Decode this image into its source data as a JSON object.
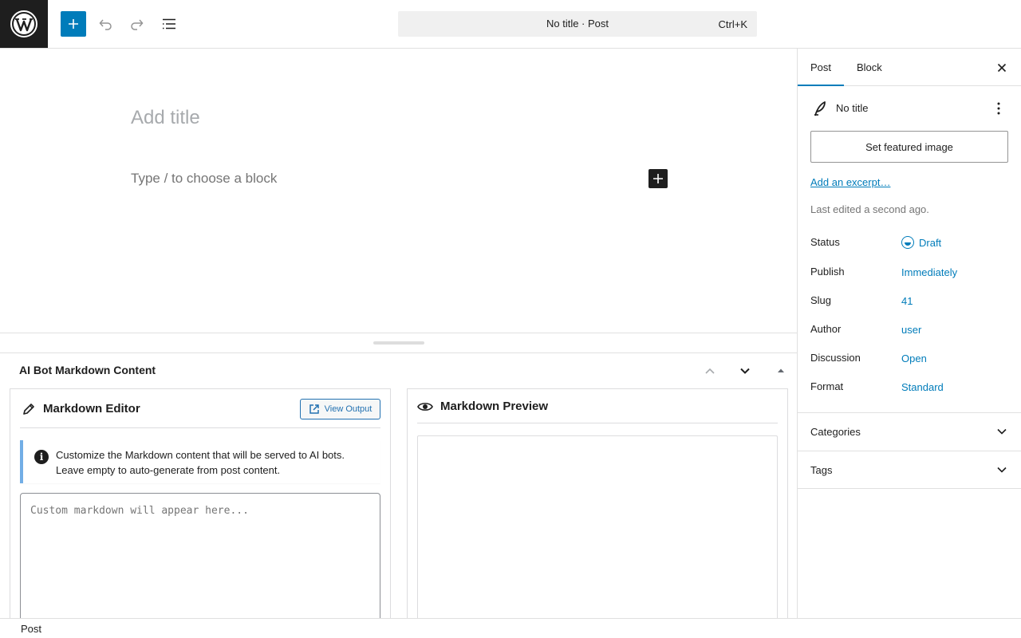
{
  "topbar": {
    "command_center_title": "No title · Post",
    "command_center_shortcut": "Ctrl+K",
    "icons": {
      "logo": "wordpress-logo-icon",
      "inserter": "plus-icon",
      "undo": "undo-icon",
      "redo": "redo-icon",
      "document_overview": "list-view-icon"
    }
  },
  "canvas": {
    "title_placeholder": "Add title",
    "block_placeholder": "Type / to choose a block"
  },
  "metabox": {
    "title": "AI Bot Markdown Content",
    "editor": {
      "title": "Markdown Editor",
      "view_output_label": "View Output",
      "notice_line1": "Customize the Markdown content that will be served to AI bots.",
      "notice_line2": "Leave empty to auto-generate from post content.",
      "textarea_placeholder": "Custom markdown will appear here..."
    },
    "preview": {
      "title": "Markdown Preview"
    }
  },
  "sidebar": {
    "tabs": [
      {
        "label": "Post",
        "active": true
      },
      {
        "label": "Block",
        "active": false
      }
    ],
    "post_title": "No title",
    "featured_image_button": "Set featured image",
    "excerpt_link": "Add an excerpt…",
    "last_edited": "Last edited a second ago.",
    "properties": [
      {
        "label": "Status",
        "value": "Draft"
      },
      {
        "label": "Publish",
        "value": "Immediately"
      },
      {
        "label": "Slug",
        "value": "41"
      },
      {
        "label": "Author",
        "value": "user"
      },
      {
        "label": "Discussion",
        "value": "Open"
      },
      {
        "label": "Format",
        "value": "Standard"
      }
    ],
    "sections": [
      {
        "label": "Categories"
      },
      {
        "label": "Tags"
      }
    ]
  },
  "footer": {
    "breadcrumb": "Post"
  },
  "colors": {
    "accent": "#007cba",
    "dark": "#1e1e1e",
    "notice_border": "#72aee6",
    "link_blue": "#2271b1"
  }
}
